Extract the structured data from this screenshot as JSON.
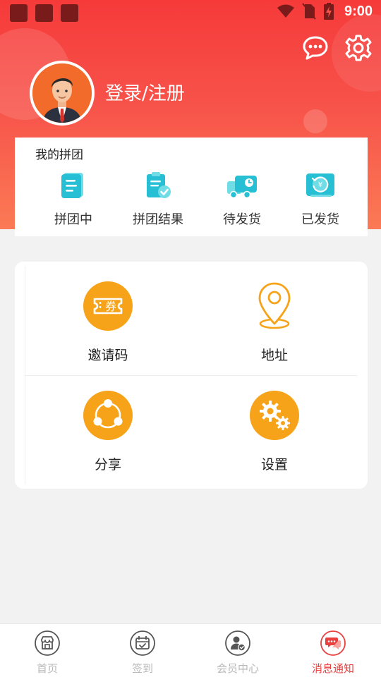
{
  "status_bar": {
    "time": "9:00"
  },
  "header": {
    "login_label": "登录/注册",
    "icons": {
      "message": "chat-bubble-icon",
      "settings": "gear-icon"
    }
  },
  "my_group": {
    "title": "我的拼团",
    "items": [
      {
        "label": "拼团中",
        "icon": "document-list-icon"
      },
      {
        "label": "拼团结果",
        "icon": "clipboard-check-icon"
      },
      {
        "label": "待发货",
        "icon": "delivery-truck-icon"
      },
      {
        "label": "已发货",
        "icon": "refund-yen-icon"
      }
    ]
  },
  "menu": {
    "items": [
      {
        "label": "邀请码",
        "icon": "coupon-icon",
        "icon_text": "券"
      },
      {
        "label": "地址",
        "icon": "location-pin-icon"
      },
      {
        "label": "分享",
        "icon": "share-icon"
      },
      {
        "label": "设置",
        "icon": "gears-icon"
      }
    ]
  },
  "tabbar": {
    "items": [
      {
        "label": "首页",
        "icon": "store-icon"
      },
      {
        "label": "签到",
        "icon": "calendar-check-icon"
      },
      {
        "label": "会员中心",
        "icon": "member-icon"
      },
      {
        "label": "消息通知",
        "icon": "message-notice-icon"
      }
    ],
    "active_index": 3
  },
  "colors": {
    "accent": "#f63a3a",
    "orange": "#f7a31a",
    "teal": "#2bc6d7",
    "tab_active": "#e93f3f"
  }
}
